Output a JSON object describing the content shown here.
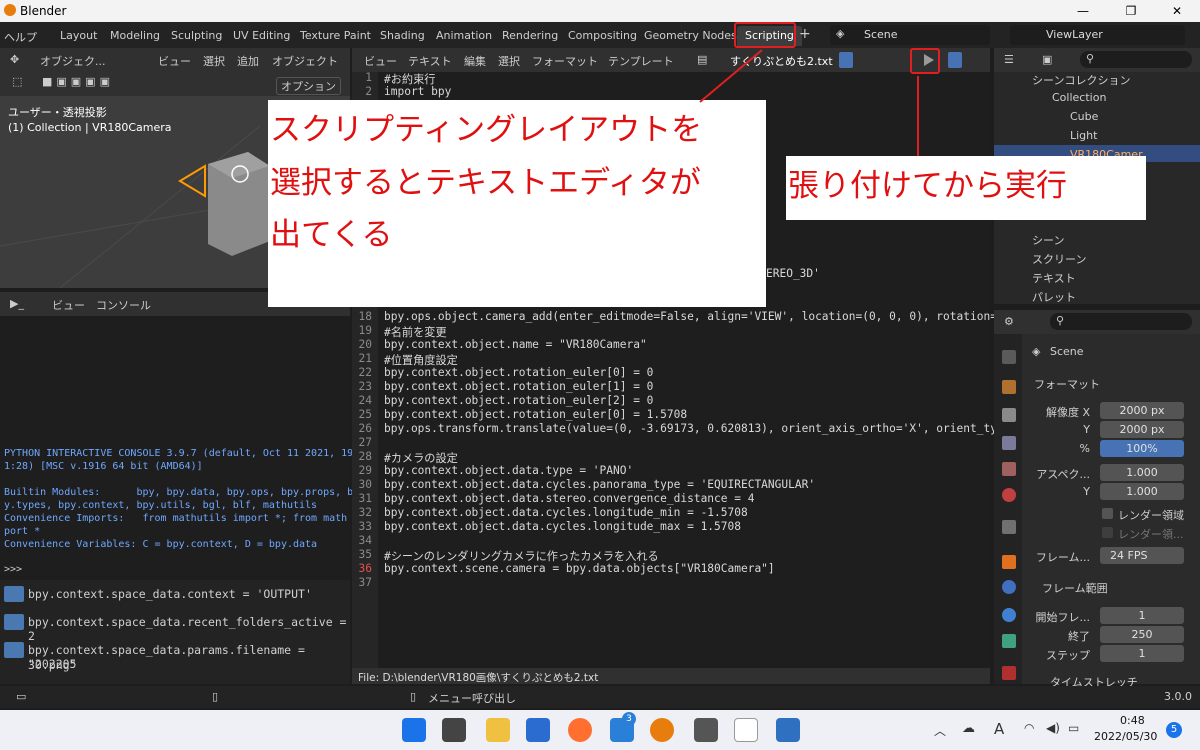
{
  "window": {
    "title": "Blender"
  },
  "menubar": {
    "help": "ヘルプ",
    "tabs": [
      "Layout",
      "Modeling",
      "Sculpting",
      "UV Editing",
      "Texture Paint",
      "Shading",
      "Animation",
      "Rendering",
      "Compositing",
      "Geometry Nodes",
      "Scripting"
    ],
    "active_tab": "Scripting",
    "plus": "+",
    "scene": "Scene",
    "viewlayer": "ViewLayer"
  },
  "viewport": {
    "header": [
      "オブジェク...",
      "ビュー",
      "選択",
      "追加",
      "オブジェクト"
    ],
    "options": "オプション",
    "info_line1": "ユーザー・透視投影",
    "info_line2": "(1) Collection | VR180Camera"
  },
  "console": {
    "header": [
      "ビュー",
      "コンソール"
    ],
    "lines": [
      "PYTHON INTERACTIVE CONSOLE 3.9.7 (default, Oct 11 2021, 19:3",
      "1:28) [MSC v.1916 64 bit (AMD64)]",
      "",
      "Builtin Modules:      bpy, bpy.data, bpy.ops, bpy.props, bp",
      "y.types, bpy.context, bpy.utils, bgl, blf, mathutils",
      "Convenience Imports:   from mathutils import *; from math im",
      "port *",
      "Convenience Variables: C = bpy.context, D = bpy.data"
    ],
    "prompt": ">>> "
  },
  "info_log": [
    "bpy.context.space_data.context = 'OUTPUT'",
    "bpy.context.space_data.recent_folders_active = 2",
    "bpy.context.space_data.params.filename = \"202205",
    "30.png\""
  ],
  "text_editor": {
    "header": [
      "ビュー",
      "テキスト",
      "編集",
      "選択",
      "フォーマット",
      "テンプレート"
    ],
    "filename": "すくりぷとめも2.txt",
    "footer": "File: D:\\blender\\VR180画像\\すくりぷとめも2.txt",
    "top_lines": [
      {
        "n": "1",
        "t": "#お約束行"
      },
      {
        "n": "2",
        "t": "import bpy"
      }
    ],
    "partial_line": "EREO_3D'",
    "lines": [
      {
        "n": "18",
        "t": "bpy.ops.object.camera_add(enter_editmode=False, align='VIEW', location=(0, 0, 0), rotation="
      },
      {
        "n": "19",
        "t": "#名前を変更"
      },
      {
        "n": "20",
        "t": "bpy.context.object.name = \"VR180Camera\""
      },
      {
        "n": "21",
        "t": "#位置角度設定"
      },
      {
        "n": "22",
        "t": "bpy.context.object.rotation_euler[0] = 0"
      },
      {
        "n": "23",
        "t": "bpy.context.object.rotation_euler[1] = 0"
      },
      {
        "n": "24",
        "t": "bpy.context.object.rotation_euler[2] = 0"
      },
      {
        "n": "25",
        "t": "bpy.context.object.rotation_euler[0] = 1.5708"
      },
      {
        "n": "26",
        "t": "bpy.ops.transform.translate(value=(0, -3.69173, 0.620813), orient_axis_ortho='X', orient_ty"
      },
      {
        "n": "27",
        "t": ""
      },
      {
        "n": "28",
        "t": "#カメラの設定"
      },
      {
        "n": "29",
        "t": "bpy.context.object.data.type = 'PANO'"
      },
      {
        "n": "30",
        "t": "bpy.context.object.data.cycles.panorama_type = 'EQUIRECTANGULAR'"
      },
      {
        "n": "31",
        "t": "bpy.context.object.data.stereo.convergence_distance = 4"
      },
      {
        "n": "32",
        "t": "bpy.context.object.data.cycles.longitude_min = -1.5708"
      },
      {
        "n": "33",
        "t": "bpy.context.object.data.cycles.longitude_max = 1.5708"
      },
      {
        "n": "34",
        "t": ""
      },
      {
        "n": "35",
        "t": "#シーンのレンダリングカメラに作ったカメラを入れる"
      },
      {
        "n": "36",
        "t": "bpy.context.scene.camera = bpy.data.objects[\"VR180Camera\"]"
      },
      {
        "n": "37",
        "t": ""
      }
    ]
  },
  "annotations": {
    "left": [
      "スクリプティングレイアウトを",
      "選択するとテキストエディタが",
      "出てくる"
    ],
    "right": "張り付けてから実行"
  },
  "outliner": {
    "scene_collection": "シーンコレクション",
    "items": [
      "Collection",
      "Cube",
      "Light",
      "VR180Camer"
    ],
    "blend_items": [
      "シーン",
      "スクリーン",
      "テキスト",
      "パレット"
    ]
  },
  "properties": {
    "scene_label": "Scene",
    "format_panel": "フォーマット",
    "res_x_label": "解像度 X",
    "res_x": "2000 px",
    "res_y_label": "Y",
    "res_y": "2000 px",
    "pct_label": "%",
    "pct": "100%",
    "aspect_label": "アスペク...",
    "aspect_x": "1.000",
    "aspect_y_label": "Y",
    "aspect_y": "1.000",
    "render_region": "レンダー領域",
    "crop_region": "レンダー領...",
    "framerate_label": "フレーム...",
    "framerate": "24 FPS",
    "frame_range_panel": "フレーム範囲",
    "start_label": "開始フレ...",
    "start": "1",
    "end_label": "終了",
    "end": "250",
    "step_label": "ステップ",
    "step": "1",
    "time_stretch": "タイムストレッチ"
  },
  "statusbar": {
    "hint": "メニュー呼び出し",
    "version": "3.0.0"
  },
  "taskbar": {
    "time": "0:48",
    "date": "2022/05/30",
    "badge_mail": "3",
    "badge_notif": "5",
    "ime": "A"
  },
  "colors": {
    "accent_blue": "#4772b3",
    "annotation_red": "#e01010",
    "blender_orange": "#e87d0d"
  }
}
